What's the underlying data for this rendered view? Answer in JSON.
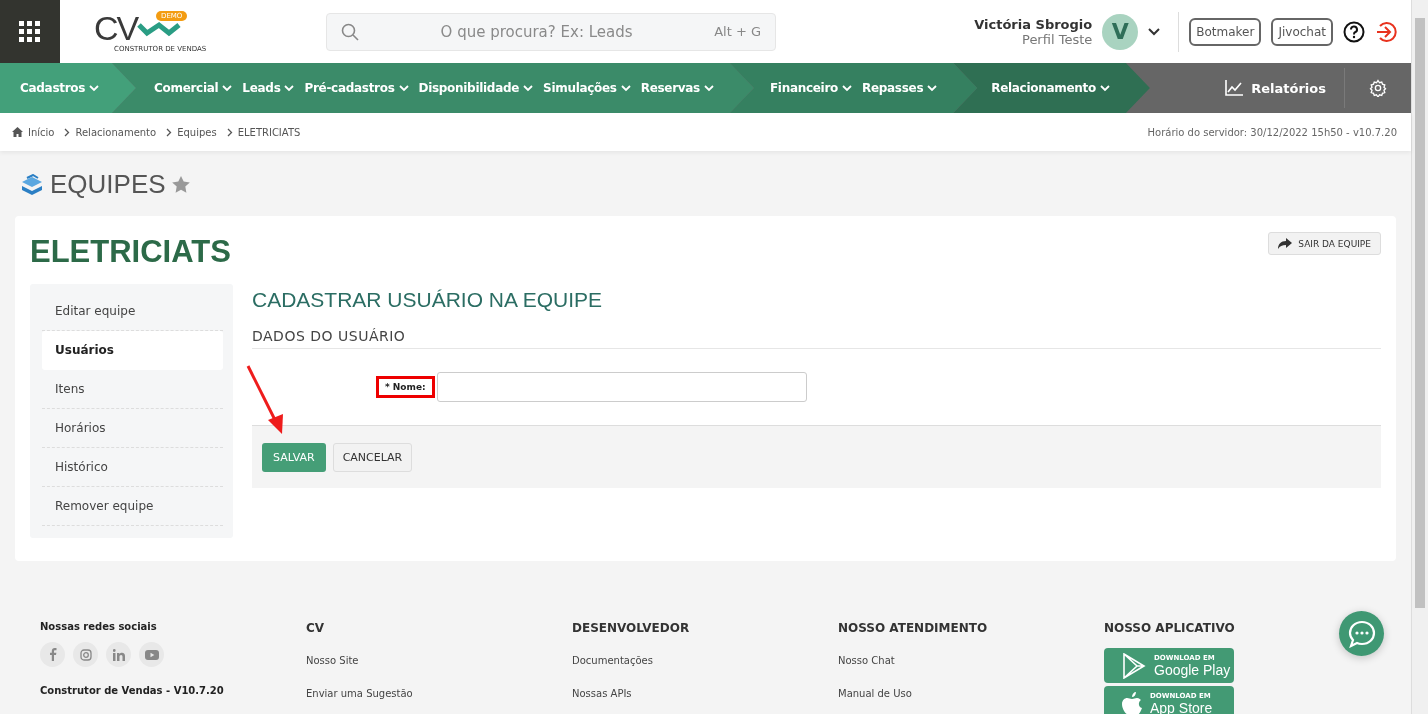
{
  "header": {
    "logo": {
      "letters": "CV",
      "badge": "DEMO",
      "tagline": "CONSTRUTOR DE VENDAS"
    },
    "search": {
      "placeholder": "O que procura? Ex: Leads",
      "shortcut": "Alt + G"
    },
    "user": {
      "name": "Victória Sbrogio",
      "profile": "Perfil Teste",
      "initial": "V"
    },
    "buttons": [
      "Botmaker",
      "Jivochat"
    ]
  },
  "nav": {
    "groups": [
      {
        "items": [
          "Cadastros"
        ]
      },
      {
        "items": [
          "Comercial",
          "Leads",
          "Pré-cadastros",
          "Disponibilidade",
          "Simulações",
          "Reservas"
        ]
      },
      {
        "items": [
          "Financeiro",
          "Repasses"
        ]
      },
      {
        "items": [
          "Relacionamento"
        ]
      }
    ],
    "reports": "Relatórios"
  },
  "breadcrumb": [
    "Início",
    "Relacionamento",
    "Equipes",
    "ELETRICIATS"
  ],
  "server_time": "Horário do servidor: 30/12/2022 15h50 - v10.7.20",
  "page_title": "EQUIPES",
  "team": {
    "name": "ELETRICIATS",
    "leave_button": "SAIR DA EQUIPE"
  },
  "sidebar": {
    "items": [
      {
        "label": "Editar equipe",
        "selected": false
      },
      {
        "label": "Usuários",
        "selected": true
      },
      {
        "label": "Itens",
        "selected": false
      },
      {
        "label": "Horários",
        "selected": false
      },
      {
        "label": "Histórico",
        "selected": false
      },
      {
        "label": "Remover equipe",
        "selected": false
      }
    ]
  },
  "form": {
    "title": "CADASTRAR USUÁRIO NA EQUIPE",
    "section": "DADOS DO USUÁRIO",
    "field": {
      "label": "* Nome:",
      "highlighted": true
    },
    "buttons": [
      "SALVAR",
      "CANCELAR"
    ]
  },
  "footer": {
    "social_title": "Nossas redes sociais",
    "version": "Construtor de Vendas - V10.7.20",
    "columns": [
      {
        "title": "CV",
        "links": [
          "Nosso Site",
          "Enviar uma Sugestão"
        ]
      },
      {
        "title": "DESENVOLVEDOR",
        "links": [
          "Documentações",
          "Nossas APIs"
        ]
      },
      {
        "title": "NOSSO ATENDIMENTO",
        "links": [
          "Nosso Chat",
          "Manual de Uso"
        ]
      }
    ],
    "app": {
      "title": "NOSSO APLICATIVO",
      "stores": [
        {
          "small": "DOWNLOAD EM",
          "big": "Google Play"
        },
        {
          "small": "DOWNLOAD EM",
          "big": "App Store"
        }
      ]
    }
  }
}
